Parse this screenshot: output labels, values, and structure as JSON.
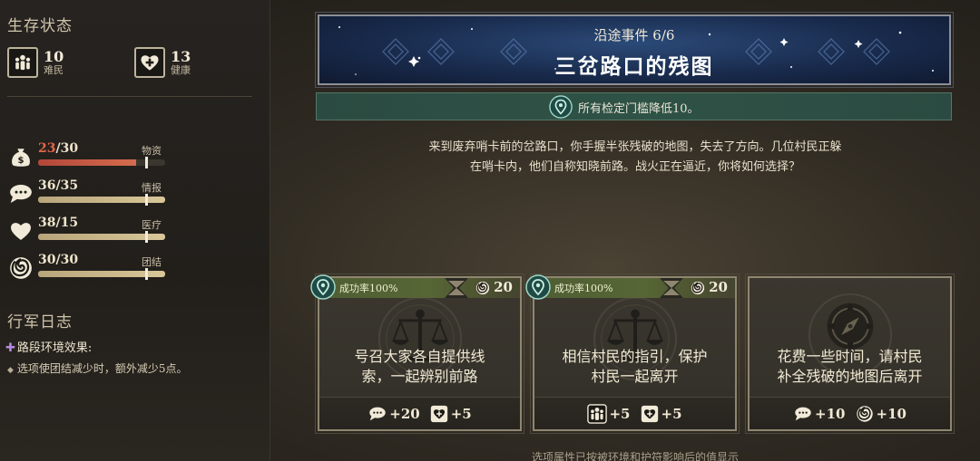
{
  "sidebar": {
    "status_title": "生存状态",
    "population": [
      {
        "icon": "refugees-icon",
        "value": "10",
        "label": "难民"
      },
      {
        "icon": "health-heart-icon",
        "value": "13",
        "label": "健康"
      }
    ],
    "resources": [
      {
        "icon": "supplies-bag-icon",
        "current": "23",
        "max": "/30",
        "label": "物资",
        "level": 0.77,
        "low": true
      },
      {
        "icon": "intel-speech-icon",
        "current": "36",
        "max": "/35",
        "label": "情报",
        "level": 1.0,
        "low": false
      },
      {
        "icon": "medical-heart-icon",
        "current": "38",
        "max": "/15",
        "label": "医疗",
        "level": 1.0,
        "low": false
      },
      {
        "icon": "unity-swirl-icon",
        "current": "30",
        "max": "/30",
        "label": "团结",
        "level": 1.0,
        "low": false
      }
    ],
    "log_title": "行军日志",
    "env_title": "路段环境效果:",
    "env_desc": "选项使团结减少时，额外减少5点。"
  },
  "event": {
    "subtitle": "沿途事件 6/6",
    "title": "三岔路口的残图",
    "rule_text": "所有检定门槛降低10。",
    "story_line1": "来到废弃哨卡前的岔路口，你手握半张残破的地图，失去了方向。几位村民正躲",
    "story_line2": "在哨卡内，他们自称知晓前路。战火正在逼近，你将如何选择？"
  },
  "options": [
    {
      "has_check": true,
      "rate": "成功率100%",
      "cost": "20",
      "line1": "号召大家各自提供线",
      "line2": "索，一起辨别前路",
      "effects": [
        {
          "icon": "intel-speech-icon",
          "value": "+20"
        },
        {
          "icon": "health-heart-icon",
          "value": "+5"
        }
      ]
    },
    {
      "has_check": true,
      "rate": "成功率100%",
      "cost": "20",
      "line1": "相信村民的指引，保护",
      "line2": "村民一起离开",
      "effects": [
        {
          "icon": "refugees-icon",
          "value": "+5"
        },
        {
          "icon": "health-heart-icon",
          "value": "+5"
        }
      ]
    },
    {
      "has_check": false,
      "line1": "花费一些时间，请村民",
      "line2": "补全残破的地图后离开",
      "effects": [
        {
          "icon": "intel-speech-icon",
          "value": "+10"
        },
        {
          "icon": "unity-swirl-icon",
          "value": "+10"
        }
      ]
    }
  ],
  "footnote": "选项属性已按被环境和护符影响后的值显示",
  "colors": {
    "accent_green": "#2f5246",
    "low_red": "#e0664a",
    "gold": "#d8c798"
  }
}
